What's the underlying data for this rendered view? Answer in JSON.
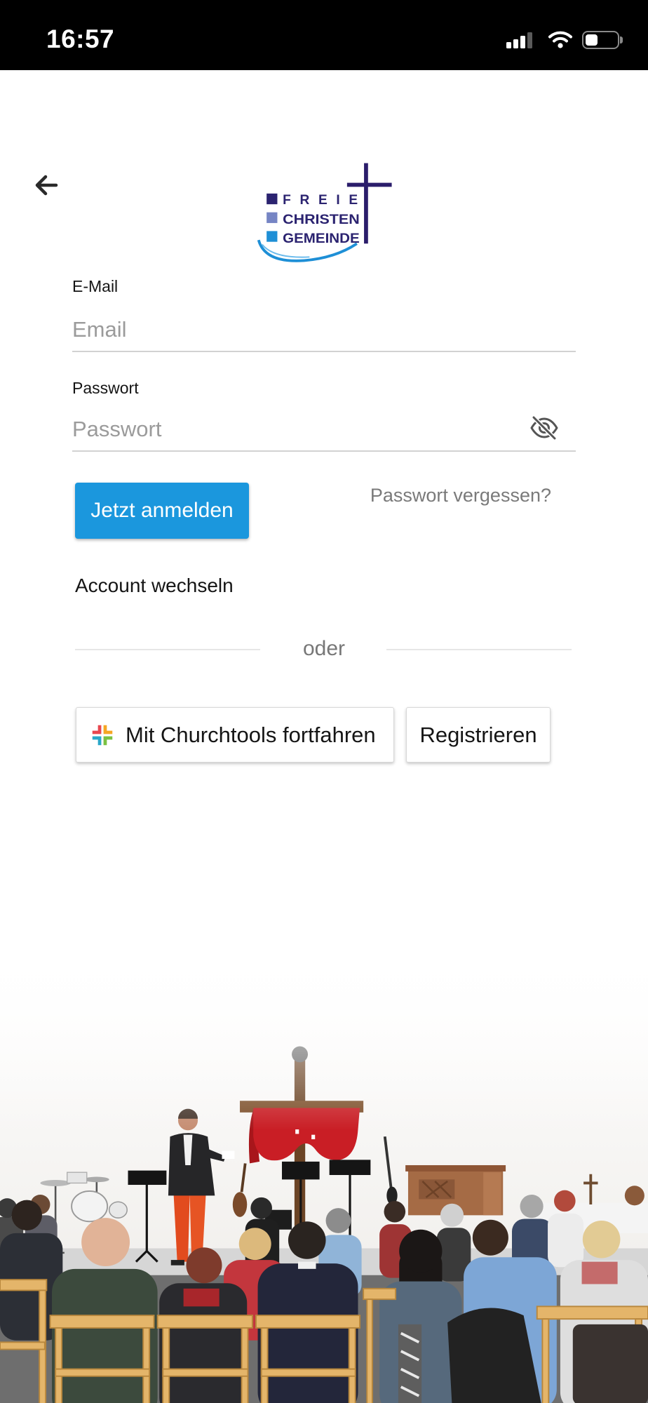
{
  "status_bar": {
    "time": "16:57",
    "signal_bars": 3,
    "signal_bars_total": 4,
    "battery_level": 0.4
  },
  "logo": {
    "line1": "FREIE",
    "line2": "CHRISTEN",
    "line3": "GEMEINDE"
  },
  "form": {
    "email": {
      "label": "E-Mail",
      "placeholder": "Email",
      "value": ""
    },
    "password": {
      "label": "Passwort",
      "placeholder": "Passwort",
      "value": ""
    }
  },
  "actions": {
    "login": "Jetzt anmelden",
    "forgot_password": "Passwort vergessen?",
    "switch_account": "Account wechseln",
    "divider": "oder",
    "churchtools": "Mit Churchtools fortfahren",
    "register": "Registrieren"
  },
  "icons": {
    "back": "arrow-left-icon",
    "password_toggle": "eye-off-icon",
    "churchtools": "churchtools-icon",
    "signal": "cellular-signal-icon",
    "wifi": "wifi-icon",
    "battery": "battery-icon"
  },
  "colors": {
    "primary": "#1b97dd",
    "logo_navy": "#2b2370",
    "logo_blue": "#1e8fd6",
    "text_muted": "#7a7a7a"
  }
}
